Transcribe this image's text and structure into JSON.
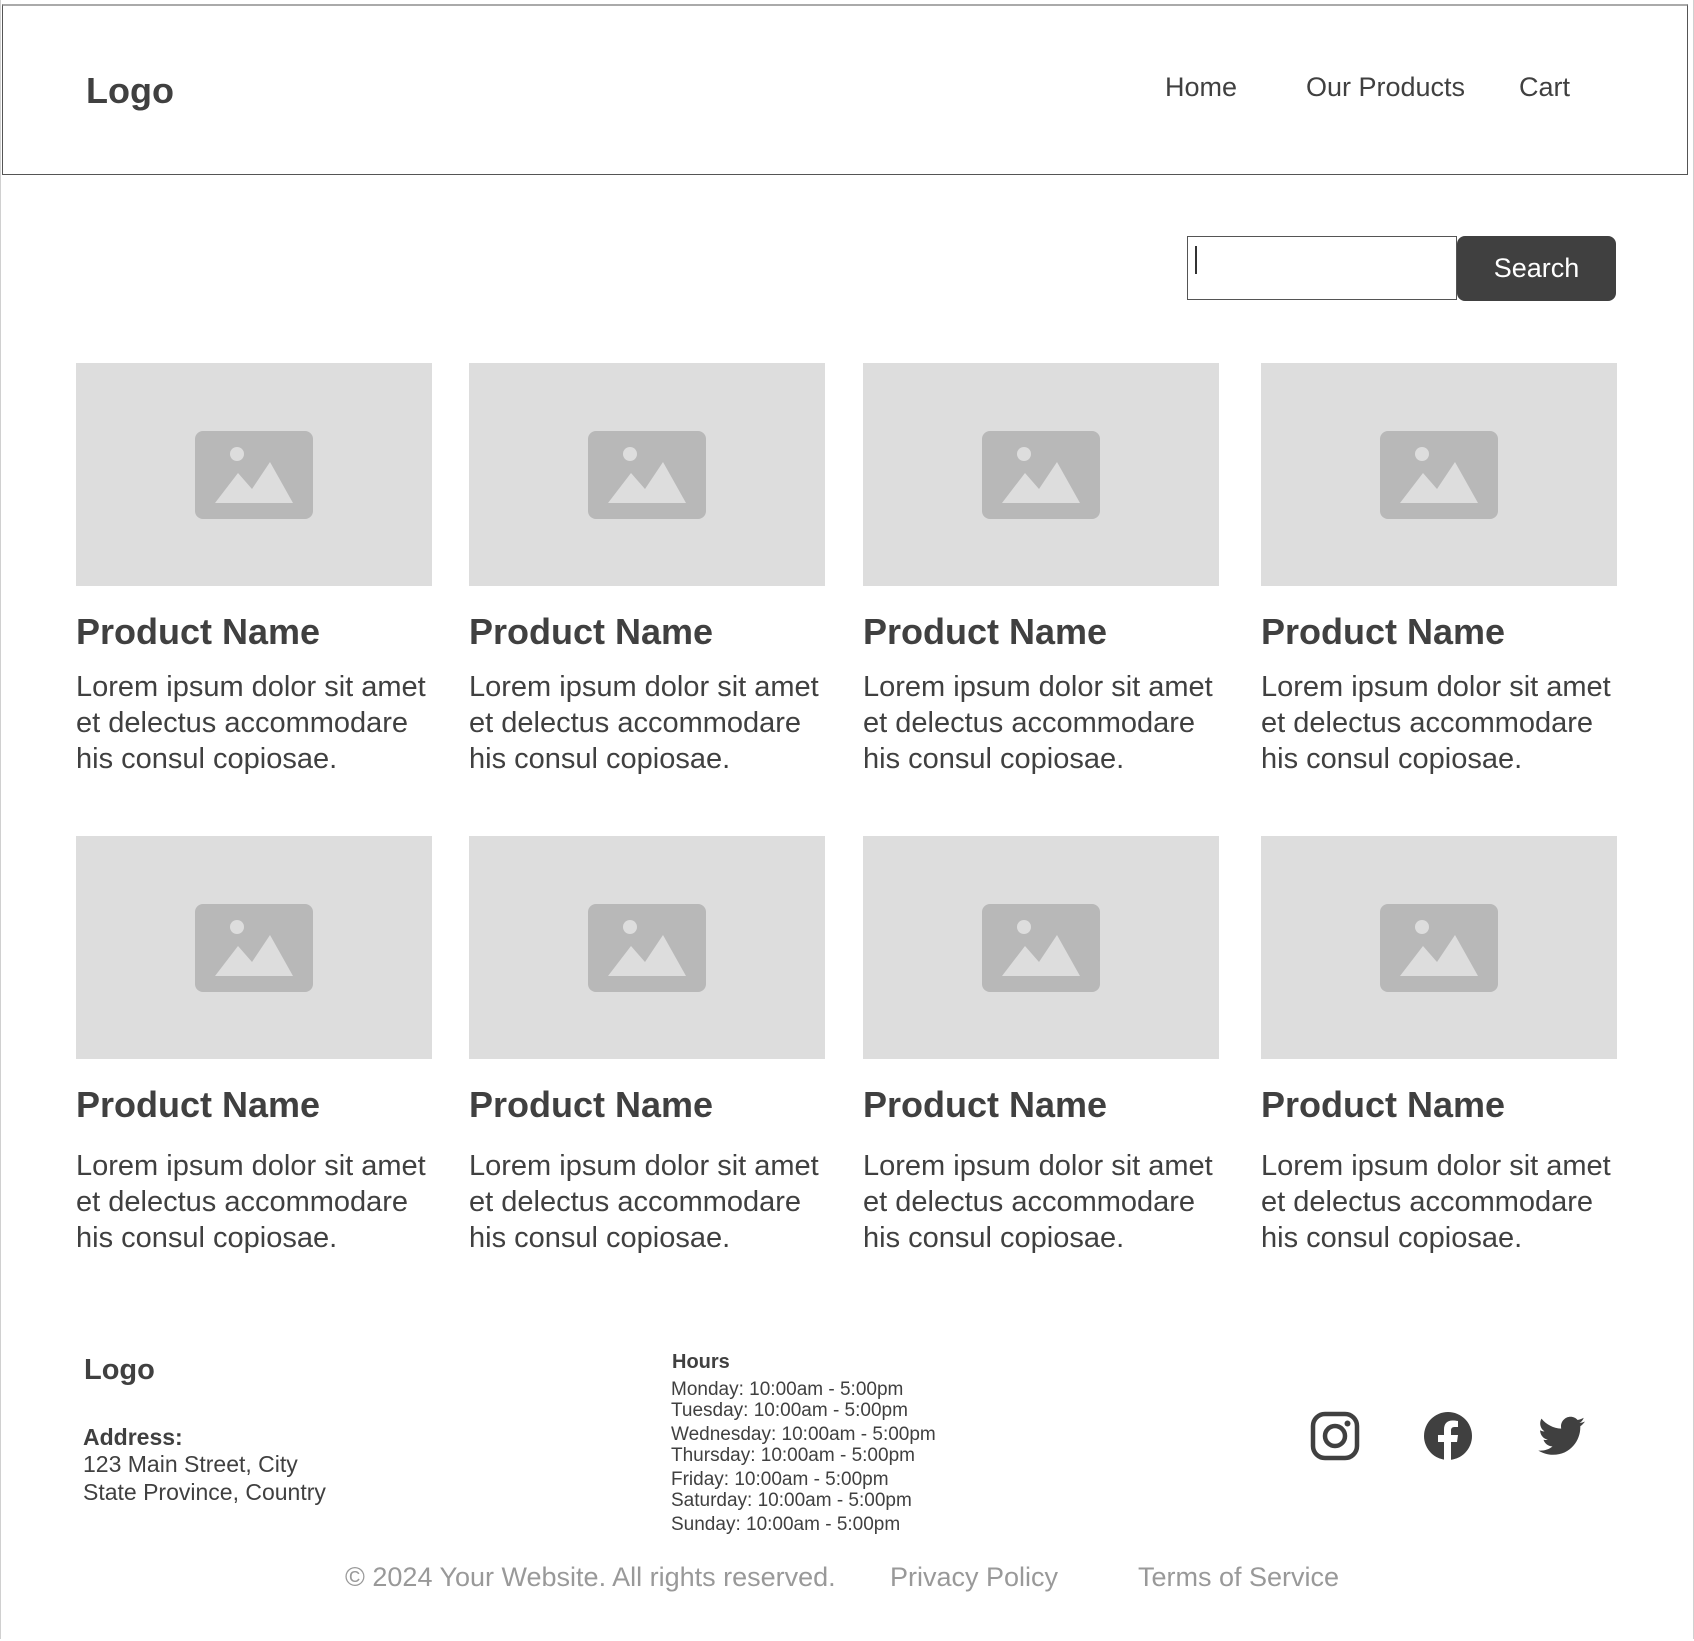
{
  "header": {
    "logo": "Logo",
    "nav": [
      "Home",
      "Our Products",
      "Cart"
    ]
  },
  "search": {
    "value": "",
    "placeholder": "",
    "button_label": "Search"
  },
  "products": [
    {
      "name": "Product Name",
      "description": "Lorem ipsum dolor sit amet et delectus accommodare his consul copiosae."
    },
    {
      "name": "Product Name",
      "description": "Lorem ipsum dolor sit amet et delectus accommodare his consul copiosae."
    },
    {
      "name": "Product Name",
      "description": "Lorem ipsum dolor sit amet et delectus accommodare his consul copiosae."
    },
    {
      "name": "Product Name",
      "description": "Lorem ipsum dolor sit amet et delectus accommodare his consul copiosae."
    },
    {
      "name": "Product Name",
      "description": "Lorem ipsum dolor sit amet et delectus accommodare his consul copiosae."
    },
    {
      "name": "Product Name",
      "description": "Lorem ipsum dolor sit amet et delectus accommodare his consul copiosae."
    },
    {
      "name": "Product Name",
      "description": "Lorem ipsum dolor sit amet et delectus accommodare his consul copiosae."
    },
    {
      "name": "Product Name",
      "description": "Lorem ipsum dolor sit amet et delectus accommodare his consul copiosae."
    }
  ],
  "footer": {
    "logo": "Logo",
    "address_label": "Address:",
    "address_lines": [
      "123 Main Street, City",
      "State Province, Country"
    ],
    "hours_title": "Hours",
    "hours": [
      "Monday: 10:00am - 5:00pm",
      "Tuesday: 10:00am - 5:00pm",
      "Wednesday: 10:00am - 5:00pm",
      "Thursday: 10:00am - 5:00pm",
      "Friday: 10:00am - 5:00pm",
      "Saturday: 10:00am - 5:00pm",
      "Sunday: 10:00am - 5:00pm"
    ],
    "social_icons": [
      "instagram-icon",
      "facebook-icon",
      "twitter-icon"
    ],
    "copyright": "© 2024 Your Website. All rights reserved.",
    "privacy": "Privacy Policy",
    "terms": "Terms of Service"
  },
  "colors": {
    "text": "#404040",
    "button_bg": "#404040",
    "image_placeholder": "#dddddd",
    "placeholder_icon": "#b8b8b8",
    "muted": "#999999"
  }
}
